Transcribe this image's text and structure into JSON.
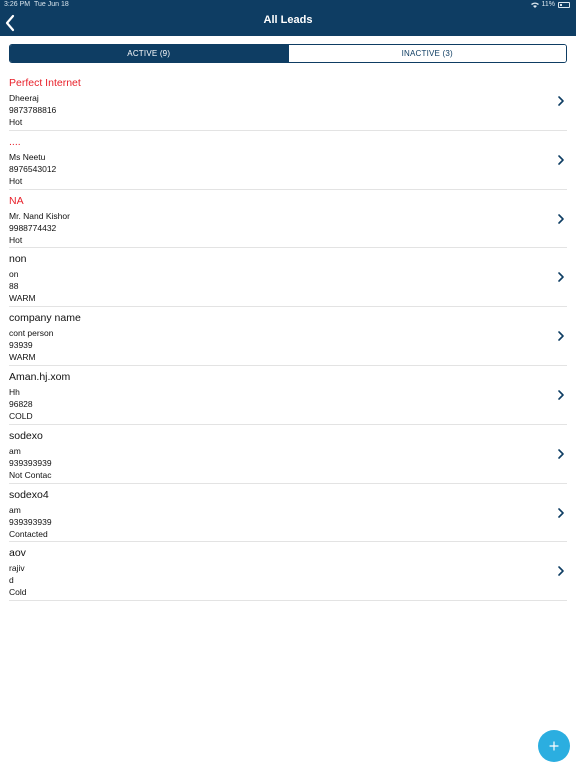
{
  "status_bar": {
    "time": "3:26 PM",
    "date": "Tue Jun 18",
    "battery": "11%"
  },
  "header": {
    "title": "All Leads"
  },
  "tabs": [
    {
      "label": "ACTIVE (9)",
      "selected": true
    },
    {
      "label": "INACTIVE (3)",
      "selected": false
    }
  ],
  "leads": [
    {
      "company": "Perfect Internet",
      "contact": "Dheeraj",
      "phone": "9873788816",
      "status": "Hot",
      "highlight": true
    },
    {
      "company": "....",
      "contact": "Ms Neetu",
      "phone": "8976543012",
      "status": "Hot",
      "highlight": true
    },
    {
      "company": "NA",
      "contact": "Mr. Nand Kishor",
      "phone": "9988774432",
      "status": "Hot",
      "highlight": true
    },
    {
      "company": "non",
      "contact": "on",
      "phone": "88",
      "status": "WARM",
      "highlight": false
    },
    {
      "company": "company name",
      "contact": "cont person",
      "phone": "93939",
      "status": "WARM",
      "highlight": false
    },
    {
      "company": "Aman.hj.xom",
      "contact": "Hh",
      "phone": "96828",
      "status": "COLD",
      "highlight": false
    },
    {
      "company": "sodexo",
      "contact": "am",
      "phone": "939393939",
      "status": "Not Contac",
      "highlight": false
    },
    {
      "company": "sodexo4",
      "contact": "am",
      "phone": "939393939",
      "status": "Contacted",
      "highlight": false
    },
    {
      "company": "aov",
      "contact": "rajiv",
      "phone": "d",
      "status": "Cold",
      "highlight": false
    }
  ],
  "colors": {
    "header": "#0e3d63",
    "highlight": "#e8202a",
    "fab": "#2baee0",
    "divider": "#e3e3e3"
  },
  "icons": {
    "back": "chevron-left-icon",
    "row": "chevron-right-icon",
    "fab": "plus-icon"
  }
}
